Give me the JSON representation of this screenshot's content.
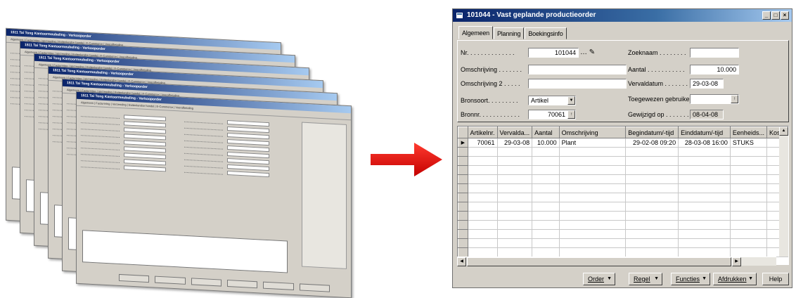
{
  "stack": {
    "window_title": "1511 Tai Tong Kantoormeubeling - Verkooporder",
    "tabs_text": "Algemeen | Facturering | Verzending | Buitenlandse handel | E-Commerce | Voorafbetaling",
    "count": 6
  },
  "window": {
    "title": "101044 - Vast geplande productieorder",
    "buttons": [
      "_",
      "□",
      "×"
    ]
  },
  "tabs": [
    "Algemeen",
    "Planning",
    "Boekingsinfo"
  ],
  "fields": {
    "nr": {
      "label": "Nr. . . . . . . . . . . . . .",
      "value": "101044"
    },
    "omschrijving": {
      "label": "Omschrijving . . . . . . .",
      "value": ""
    },
    "omschrijving2": {
      "label": "Omschrijving 2 . . . . .",
      "value": ""
    },
    "bronsoort": {
      "label": "Bronsoort. . . . . . . . .",
      "value": "Artikel"
    },
    "bronnr": {
      "label": "Bronnr. . . . . . . . . . . .",
      "value": "70061"
    },
    "zoeknaam": {
      "label": "Zoeknaam . . . . . . . .",
      "value": ""
    },
    "aantal": {
      "label": "Aantal . . . . . . . . . . .",
      "value": "10.000"
    },
    "vervaldatum": {
      "label": "Vervaldatum . . . . . . .",
      "value": "29-03-08"
    },
    "toegewezen": {
      "label": "Toegewezen gebruiker . . .",
      "value": ""
    },
    "gewijzigd": {
      "label": "Gewijzigd op . . . . . . . .",
      "value": "08-04-08"
    }
  },
  "grid": {
    "columns": [
      "Artikelnr.",
      "Vervalda...",
      "Aantal",
      "Omschrijving",
      "Begindatum/-tijd",
      "Einddatum/-tijd",
      "Eenheids...",
      "Kostp"
    ],
    "rows": [
      [
        "70061",
        "29-03-08",
        "10.000",
        "Plant",
        "29-02-08 09:20",
        "28-03-08 16:00",
        "STUKS",
        ""
      ]
    ],
    "empty_rows": 12
  },
  "buttons": [
    "Order",
    "Regel",
    "Functies",
    "Afdrukken",
    "Help"
  ]
}
